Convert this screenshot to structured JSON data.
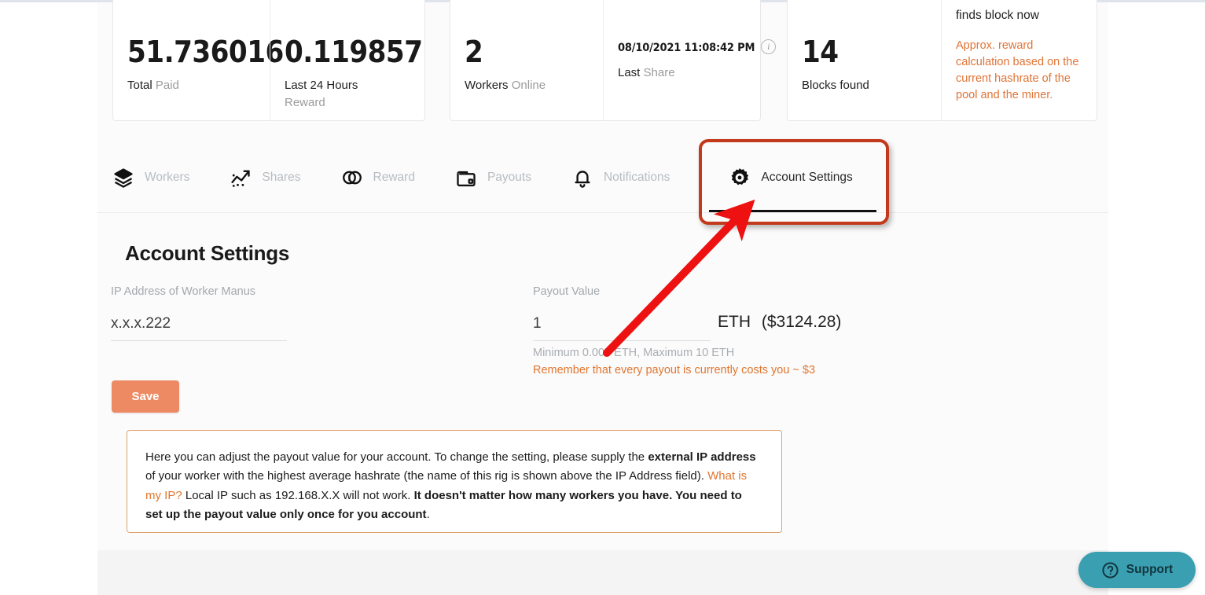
{
  "stats": {
    "cards": [
      {
        "value": "51.736016",
        "label_strong": "Total",
        "label_muted": "Paid",
        "sub": ""
      },
      {
        "value": "0.119857",
        "label_strong": "Last 24 Hours",
        "label_muted": "",
        "sub": "Reward"
      },
      {
        "value": "2",
        "label_strong": "Workers",
        "label_muted": "Online",
        "sub": ""
      },
      {
        "value": "08/10/2021 11:08:42 PM",
        "label_strong": "Last",
        "label_muted": "Share",
        "sub": "",
        "icon": "info-icon"
      },
      {
        "value": "14",
        "label_strong": "Blocks found",
        "label_muted": "",
        "sub": ""
      }
    ],
    "note": {
      "heading": "finds block now",
      "body": "Approx. reward calculation based on the current hashrate of the pool and the miner."
    }
  },
  "tabs": [
    {
      "label": "Workers",
      "icon": "layers-icon",
      "active": false
    },
    {
      "label": "Shares",
      "icon": "trending-up-icon",
      "active": false
    },
    {
      "label": "Reward",
      "icon": "coins-icon",
      "active": false
    },
    {
      "label": "Payouts",
      "icon": "wallet-icon",
      "active": false
    },
    {
      "label": "Notifications",
      "icon": "bell-icon",
      "active": false
    },
    {
      "label": "Account Settings",
      "icon": "gear-icon",
      "active": true
    }
  ],
  "form": {
    "title": "Account Settings",
    "ip": {
      "label": "IP Address of Worker Manus",
      "value": "x.x.x.222",
      "placeholder": "x.x.x.222"
    },
    "payout": {
      "label": "Payout Value",
      "value": "1",
      "placeholder": "1",
      "unit": "ETH",
      "usd": "($3124.28)",
      "hint": "Minimum 0.005 ETH, Maximum 10 ETH",
      "warning": "Remember that every payout is currently costs you ~ $3"
    },
    "save_label": "Save"
  },
  "infobox": {
    "p1": "Here you can adjust the payout value for your account. To change the setting, please supply the ",
    "b1": "external IP address",
    "p2": " of your worker with the highest average hashrate (the name of this rig is shown above the IP Address field). ",
    "link": "What is my IP?",
    "p3": " Local IP such as 192.168.X.X will not work. ",
    "b2": "It doesn't matter how many workers you have. You need to set up the payout value only once for you account",
    "p4": "."
  },
  "support": {
    "label": "Support",
    "icon": "question-circle-icon"
  },
  "annotation": {
    "type": "arrow",
    "color": "#ee1111",
    "points": "from (772,448) to (947,268)"
  },
  "colors": {
    "accent_orange": "#e0762f",
    "save_button": "#ee8a63",
    "highlight_border": "#c2391b",
    "arrow_red": "#ee1111",
    "support_teal": "#3a9fb0"
  }
}
